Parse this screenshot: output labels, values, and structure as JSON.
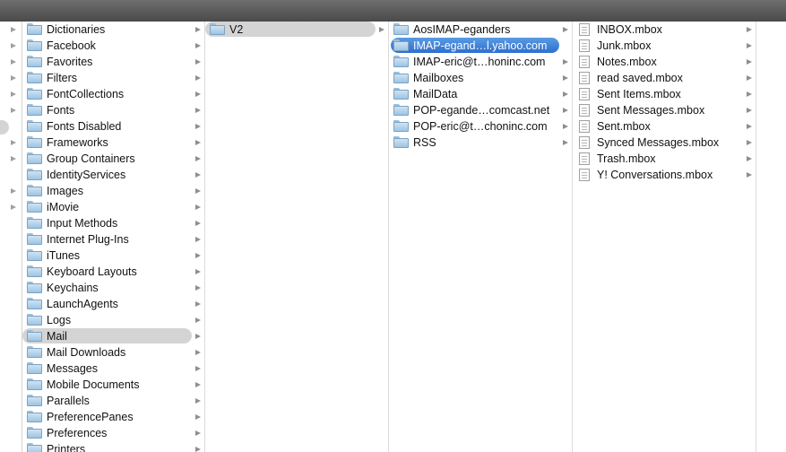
{
  "column1": {
    "items": [
      {
        "label": "Dictionaries",
        "has_children": true
      },
      {
        "label": "Facebook",
        "has_children": true
      },
      {
        "label": "Favorites",
        "has_children": true
      },
      {
        "label": "Filters",
        "has_children": true
      },
      {
        "label": "FontCollections",
        "has_children": true
      },
      {
        "label": "Fonts",
        "has_children": true
      },
      {
        "label": "Fonts Disabled",
        "has_children": true
      },
      {
        "label": "Frameworks",
        "has_children": true
      },
      {
        "label": "Group Containers",
        "has_children": true
      },
      {
        "label": "IdentityServices",
        "has_children": true
      },
      {
        "label": "Images",
        "has_children": true
      },
      {
        "label": "iMovie",
        "has_children": true
      },
      {
        "label": "Input Methods",
        "has_children": true
      },
      {
        "label": "Internet Plug-Ins",
        "has_children": true
      },
      {
        "label": "iTunes",
        "has_children": true
      },
      {
        "label": "Keyboard Layouts",
        "has_children": true
      },
      {
        "label": "Keychains",
        "has_children": true
      },
      {
        "label": "LaunchAgents",
        "has_children": true
      },
      {
        "label": "Logs",
        "has_children": true
      },
      {
        "label": "Mail",
        "has_children": true,
        "selected": "grey"
      },
      {
        "label": "Mail Downloads",
        "has_children": true
      },
      {
        "label": "Messages",
        "has_children": true
      },
      {
        "label": "Mobile Documents",
        "has_children": true
      },
      {
        "label": "Parallels",
        "has_children": true
      },
      {
        "label": "PreferencePanes",
        "has_children": true
      },
      {
        "label": "Preferences",
        "has_children": true
      },
      {
        "label": "Printers",
        "has_children": true
      }
    ]
  },
  "column2": {
    "items": [
      {
        "label": "V2",
        "has_children": true,
        "selected": "grey"
      }
    ]
  },
  "column3": {
    "items": [
      {
        "label": "AosIMAP-eganders",
        "has_children": true
      },
      {
        "label": "IMAP-egand…l.yahoo.com",
        "has_children": true,
        "selected": "blue"
      },
      {
        "label": "IMAP-eric@t…honinc.com",
        "has_children": true
      },
      {
        "label": "Mailboxes",
        "has_children": true
      },
      {
        "label": "MailData",
        "has_children": true
      },
      {
        "label": "POP-egande…comcast.net",
        "has_children": true
      },
      {
        "label": "POP-eric@t…choninc.com",
        "has_children": true
      },
      {
        "label": "RSS",
        "has_children": true
      }
    ]
  },
  "column4": {
    "items": [
      {
        "label": "INBOX.mbox",
        "has_children": true
      },
      {
        "label": "Junk.mbox",
        "has_children": true
      },
      {
        "label": "Notes.mbox",
        "has_children": true
      },
      {
        "label": "read saved.mbox",
        "has_children": true
      },
      {
        "label": "Sent Items.mbox",
        "has_children": true
      },
      {
        "label": "Sent Messages.mbox",
        "has_children": true
      },
      {
        "label": "Sent.mbox",
        "has_children": true
      },
      {
        "label": "Synced Messages.mbox",
        "has_children": true
      },
      {
        "label": "Trash.mbox",
        "has_children": true
      },
      {
        "label": "Y! Conversations.mbox",
        "has_children": true
      }
    ]
  },
  "colors": {
    "selection_blue": "#3a7ed8",
    "selection_grey": "#d4d4d4",
    "titlebar": "#5a5a5a"
  },
  "icons": {
    "folder": "folder-icon",
    "mbox": "mbox-package-icon",
    "disclosure": "chevron-right-icon"
  }
}
